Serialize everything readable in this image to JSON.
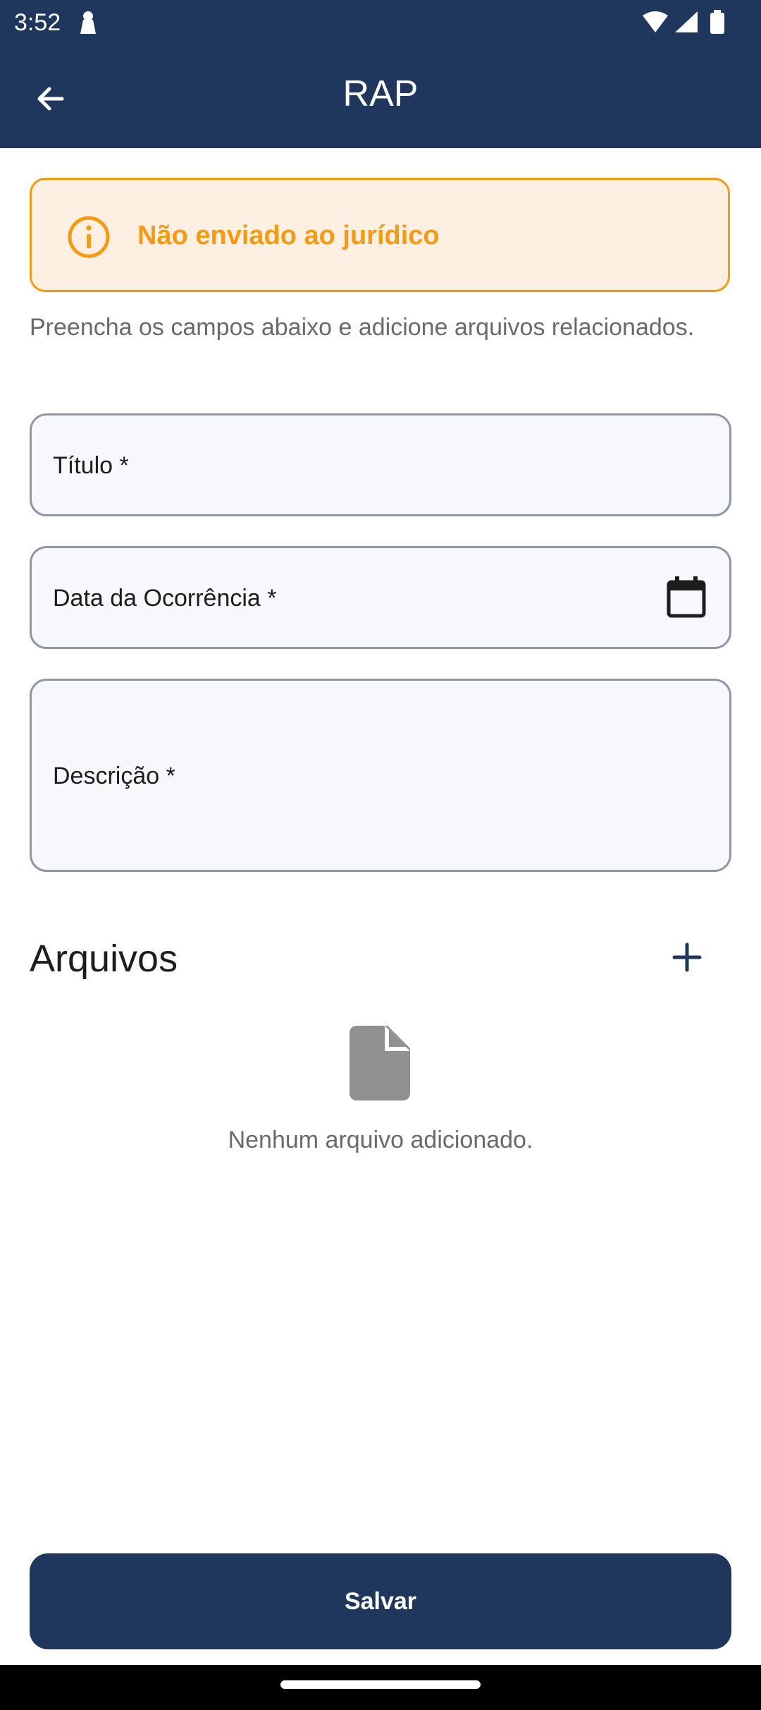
{
  "status_bar": {
    "time": "3:52"
  },
  "app_bar": {
    "title": "RAP",
    "back_icon": "arrow-back-icon"
  },
  "warning": {
    "icon": "info-icon",
    "text": "Não enviado ao jurídico",
    "color": "#f59a14",
    "background": "#fdf0e3"
  },
  "instructions": "Preencha os campos abaixo e adicione arquivos relacionados.",
  "form": {
    "title_label": "Título *",
    "date_label": "Data da Ocorrência *",
    "description_label": "Descrição *"
  },
  "files": {
    "heading": "Arquivos",
    "empty_text": "Nenhum arquivo adicionado.",
    "add_icon": "plus-icon",
    "empty_icon": "file-icon"
  },
  "actions": {
    "save_label": "Salvar"
  },
  "colors": {
    "primary": "#1f375c",
    "field_border": "#8f97a6",
    "field_background": "#f6f8fb",
    "muted_text": "#6a6a6a"
  }
}
